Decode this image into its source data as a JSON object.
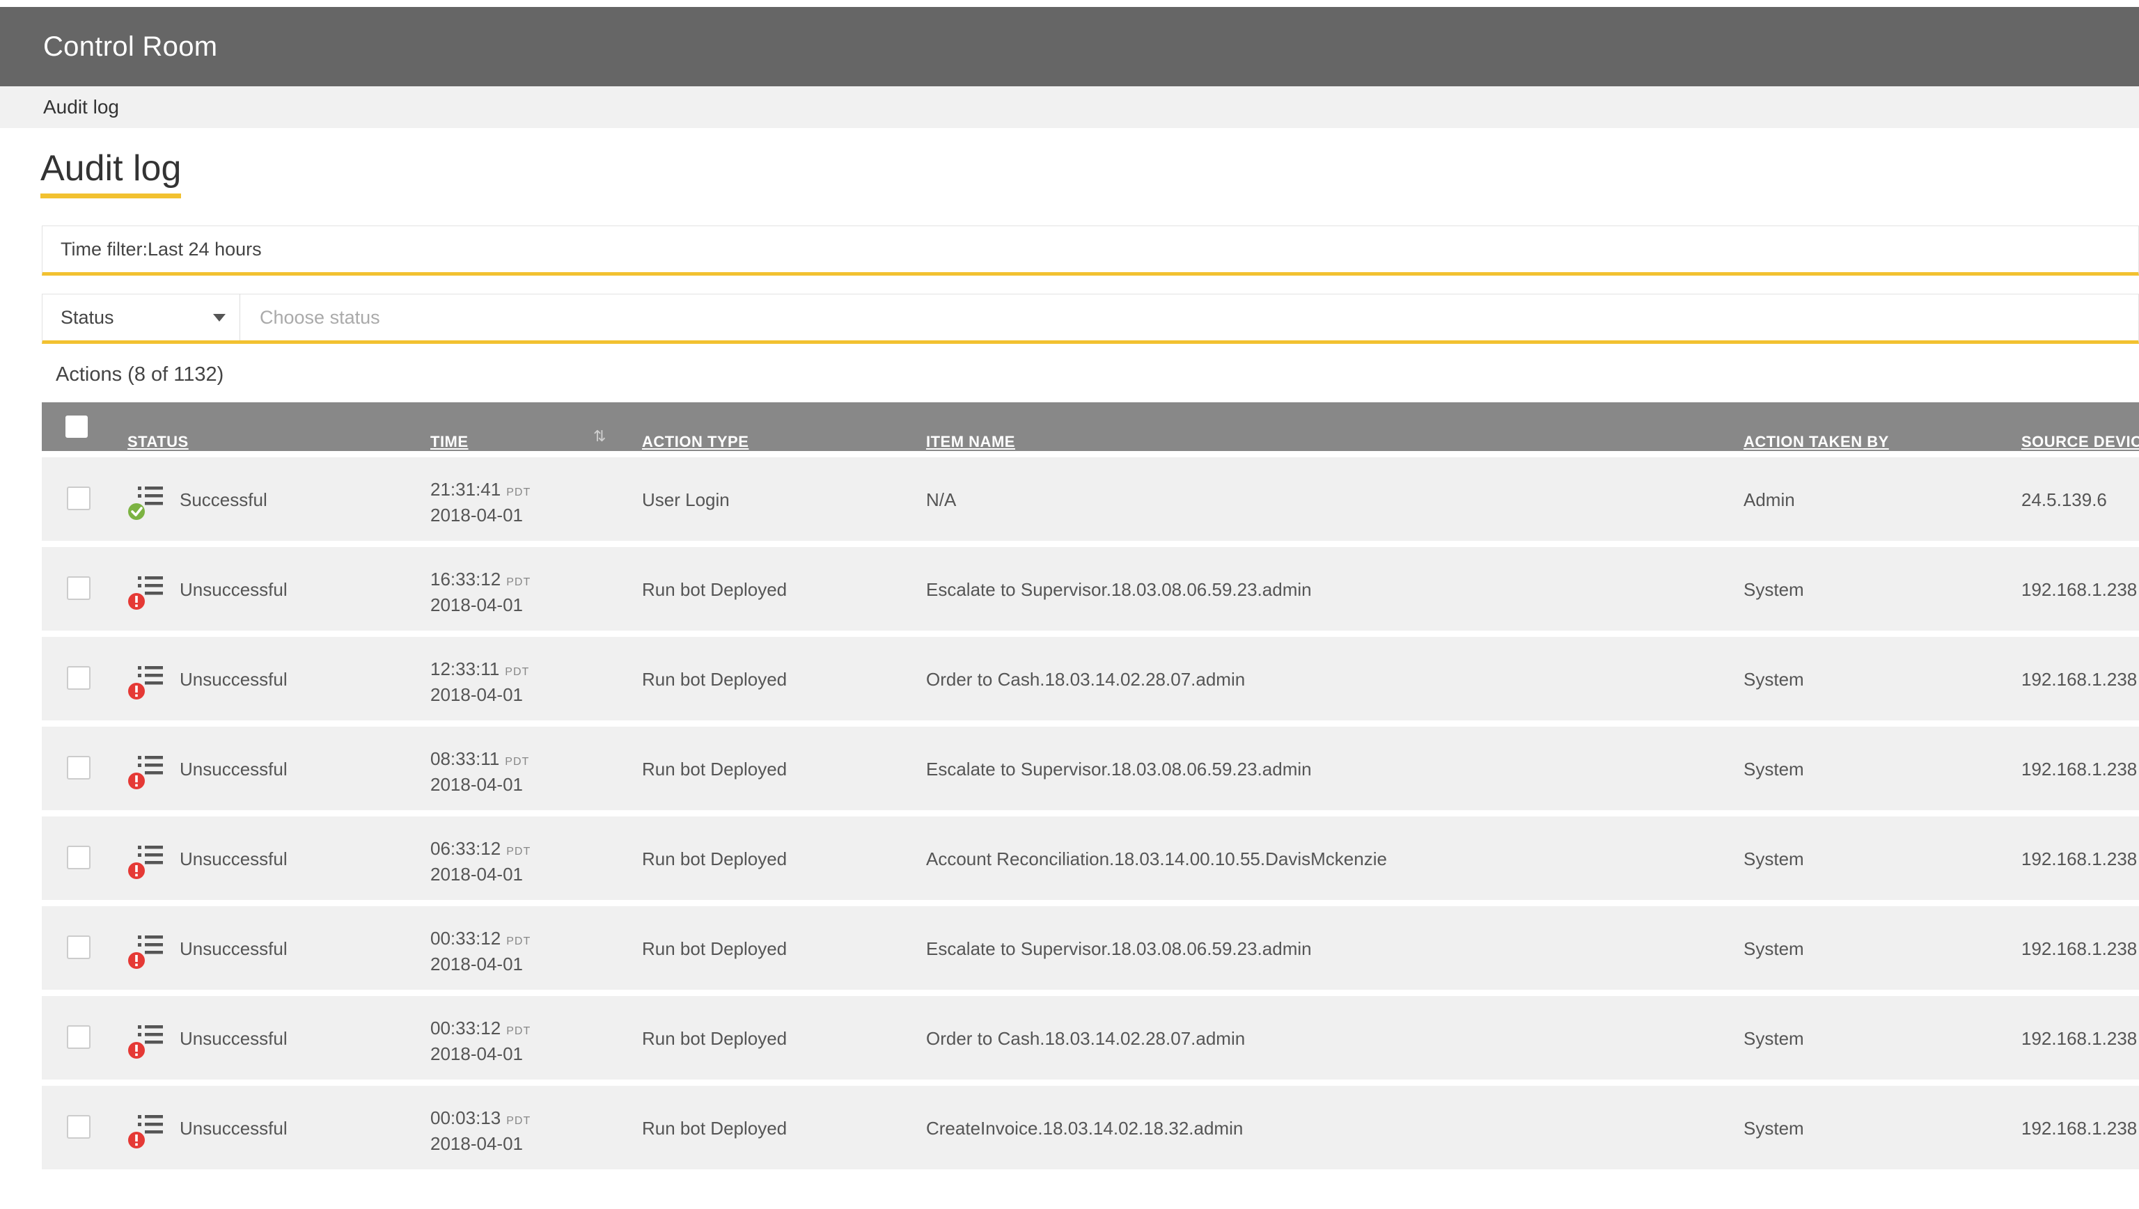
{
  "app": {
    "title": "Control Room"
  },
  "breadcrumb": "Audit log",
  "page_title": "Audit log",
  "time_filter": "Time filter:Last 24 hours",
  "status_filter": {
    "selected": "Status",
    "placeholder": "Choose status"
  },
  "actions_count": "Actions (8 of 1132)",
  "table": {
    "headers": {
      "status": "STATUS",
      "time": "TIME",
      "action_type": "ACTION TYPE",
      "item_name": "ITEM NAME",
      "action_taken_by": "ACTION TAKEN BY",
      "source_device": "SOURCE DEVIC"
    },
    "sort_glyph": "⇅",
    "rows": [
      {
        "status": "Successful",
        "time": "21:31:41",
        "tz": "PDT",
        "date": "2018-04-01",
        "action_type": "User Login",
        "item_name": "N/A",
        "taken_by": "Admin",
        "source": "24.5.139.6",
        "status_kind": "success"
      },
      {
        "status": "Unsuccessful",
        "time": "16:33:12",
        "tz": "PDT",
        "date": "2018-04-01",
        "action_type": "Run bot Deployed",
        "item_name": "Escalate to Supervisor.18.03.08.06.59.23.admin",
        "taken_by": "System",
        "source": "192.168.1.238",
        "status_kind": "error"
      },
      {
        "status": "Unsuccessful",
        "time": "12:33:11",
        "tz": "PDT",
        "date": "2018-04-01",
        "action_type": "Run bot Deployed",
        "item_name": "Order to Cash.18.03.14.02.28.07.admin",
        "taken_by": "System",
        "source": "192.168.1.238",
        "status_kind": "error"
      },
      {
        "status": "Unsuccessful",
        "time": "08:33:11",
        "tz": "PDT",
        "date": "2018-04-01",
        "action_type": "Run bot Deployed",
        "item_name": "Escalate to Supervisor.18.03.08.06.59.23.admin",
        "taken_by": "System",
        "source": "192.168.1.238",
        "status_kind": "error"
      },
      {
        "status": "Unsuccessful",
        "time": "06:33:12",
        "tz": "PDT",
        "date": "2018-04-01",
        "action_type": "Run bot Deployed",
        "item_name": "Account Reconciliation.18.03.14.00.10.55.DavisMckenzie",
        "taken_by": "System",
        "source": "192.168.1.238",
        "status_kind": "error"
      },
      {
        "status": "Unsuccessful",
        "time": "00:33:12",
        "tz": "PDT",
        "date": "2018-04-01",
        "action_type": "Run bot Deployed",
        "item_name": "Escalate to Supervisor.18.03.08.06.59.23.admin",
        "taken_by": "System",
        "source": "192.168.1.238",
        "status_kind": "error"
      },
      {
        "status": "Unsuccessful",
        "time": "00:33:12",
        "tz": "PDT",
        "date": "2018-04-01",
        "action_type": "Run bot Deployed",
        "item_name": "Order to Cash.18.03.14.02.28.07.admin",
        "taken_by": "System",
        "source": "192.168.1.238",
        "status_kind": "error"
      },
      {
        "status": "Unsuccessful",
        "time": "00:03:13",
        "tz": "PDT",
        "date": "2018-04-01",
        "action_type": "Run bot Deployed",
        "item_name": "CreateInvoice.18.03.14.02.18.32.admin",
        "taken_by": "System",
        "source": "192.168.1.238",
        "status_kind": "error"
      }
    ]
  },
  "colors": {
    "accent": "#f2c130",
    "topbar": "#666666",
    "table_header": "#888888",
    "success": "#7cb342",
    "error": "#e53935"
  },
  "icons": {
    "success_status": "list-check-icon",
    "error_status": "list-alert-icon",
    "dropdown": "caret-down-icon",
    "sort": "sort-icon"
  }
}
